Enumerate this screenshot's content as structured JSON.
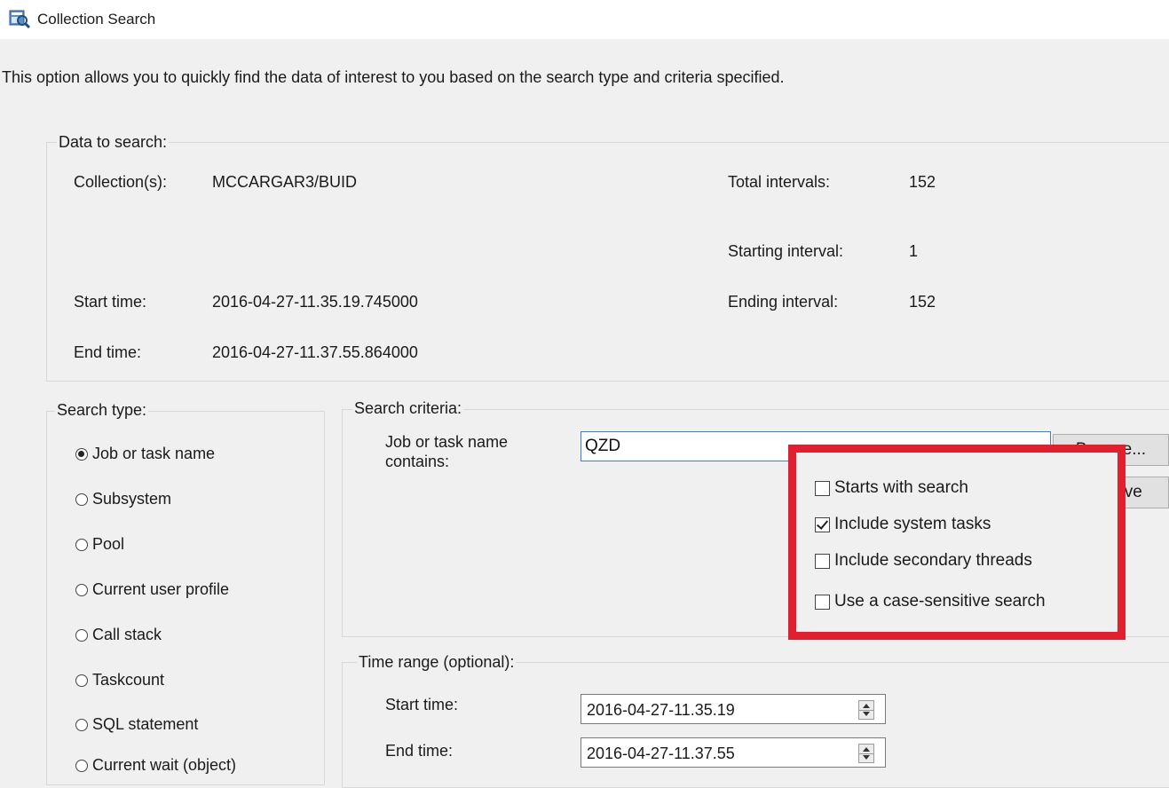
{
  "window": {
    "title": "Collection Search",
    "icon": "collection-search-icon"
  },
  "description": "This option allows you to quickly find the data of interest to you based on the search type and criteria specified.",
  "data_to_search": {
    "label": "Data to search:",
    "collections_label": "Collection(s):",
    "collections_value": "MCCARGAR3/BUID",
    "start_time_label": "Start time:",
    "start_time_value": "2016-04-27-11.35.19.745000",
    "end_time_label": "End time:",
    "end_time_value": "2016-04-27-11.37.55.864000",
    "total_intervals_label": "Total intervals:",
    "total_intervals_value": "152",
    "starting_interval_label": "Starting interval:",
    "starting_interval_value": "1",
    "ending_interval_label": "Ending interval:",
    "ending_interval_value": "152"
  },
  "search_type": {
    "label": "Search type:",
    "selected": "Job or task name",
    "options": [
      "Job or task name",
      "Subsystem",
      "Pool",
      "Current user profile",
      "Call stack",
      "Taskcount",
      "SQL statement",
      "Current wait (object)"
    ]
  },
  "search_criteria": {
    "label": "Search criteria:",
    "field_label_line1": "Job or task name",
    "field_label_line2": "contains:",
    "field_value": "QZD",
    "browse_label": "Browse...",
    "remove_label": "Remove",
    "options": [
      {
        "label": "Starts with search",
        "checked": false
      },
      {
        "label": "Include system tasks",
        "checked": true
      },
      {
        "label": "Include secondary threads",
        "checked": false
      },
      {
        "label": "Use a case-sensitive search",
        "checked": false
      }
    ]
  },
  "time_range": {
    "label": "Time range (optional):",
    "start_label": "Start time:",
    "start_value": "2016-04-27-11.35.19",
    "end_label": "End time:",
    "end_value": "2016-04-27-11.37.55"
  },
  "colors": {
    "highlight": "#e0202e",
    "focus_border": "#3c7fd6",
    "background": "#f0f0f0"
  }
}
